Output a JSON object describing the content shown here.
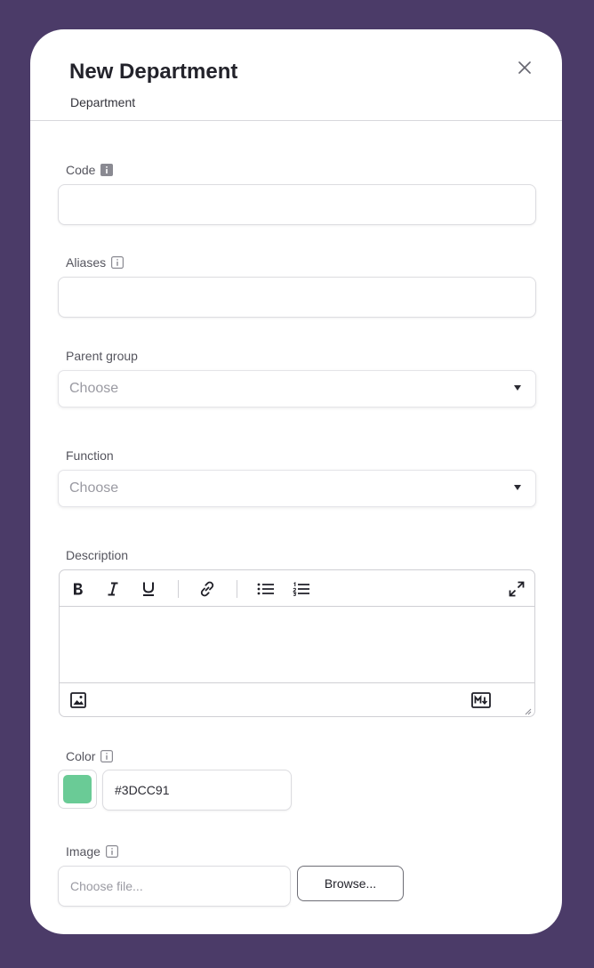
{
  "modal": {
    "title": "New Department",
    "subtitle": "Department"
  },
  "fields": {
    "code": {
      "label": "Code",
      "value": ""
    },
    "aliases": {
      "label": "Aliases",
      "value": ""
    },
    "parent_group": {
      "label": "Parent group",
      "placeholder": "Choose"
    },
    "function": {
      "label": "Function",
      "placeholder": "Choose"
    },
    "description": {
      "label": "Description",
      "value": ""
    },
    "color": {
      "label": "Color",
      "value": "#3DCC91"
    },
    "image": {
      "label": "Image",
      "placeholder": "Choose file...",
      "button_label": "Browse..."
    }
  },
  "editor_toolbar": [
    "bold-icon",
    "italic-icon",
    "underline-icon",
    "link-icon",
    "bullet-list-icon",
    "numbered-list-icon",
    "fullscreen-icon"
  ],
  "colors": {
    "backdrop": "#4b3b68",
    "swatch": "#6acb96"
  }
}
